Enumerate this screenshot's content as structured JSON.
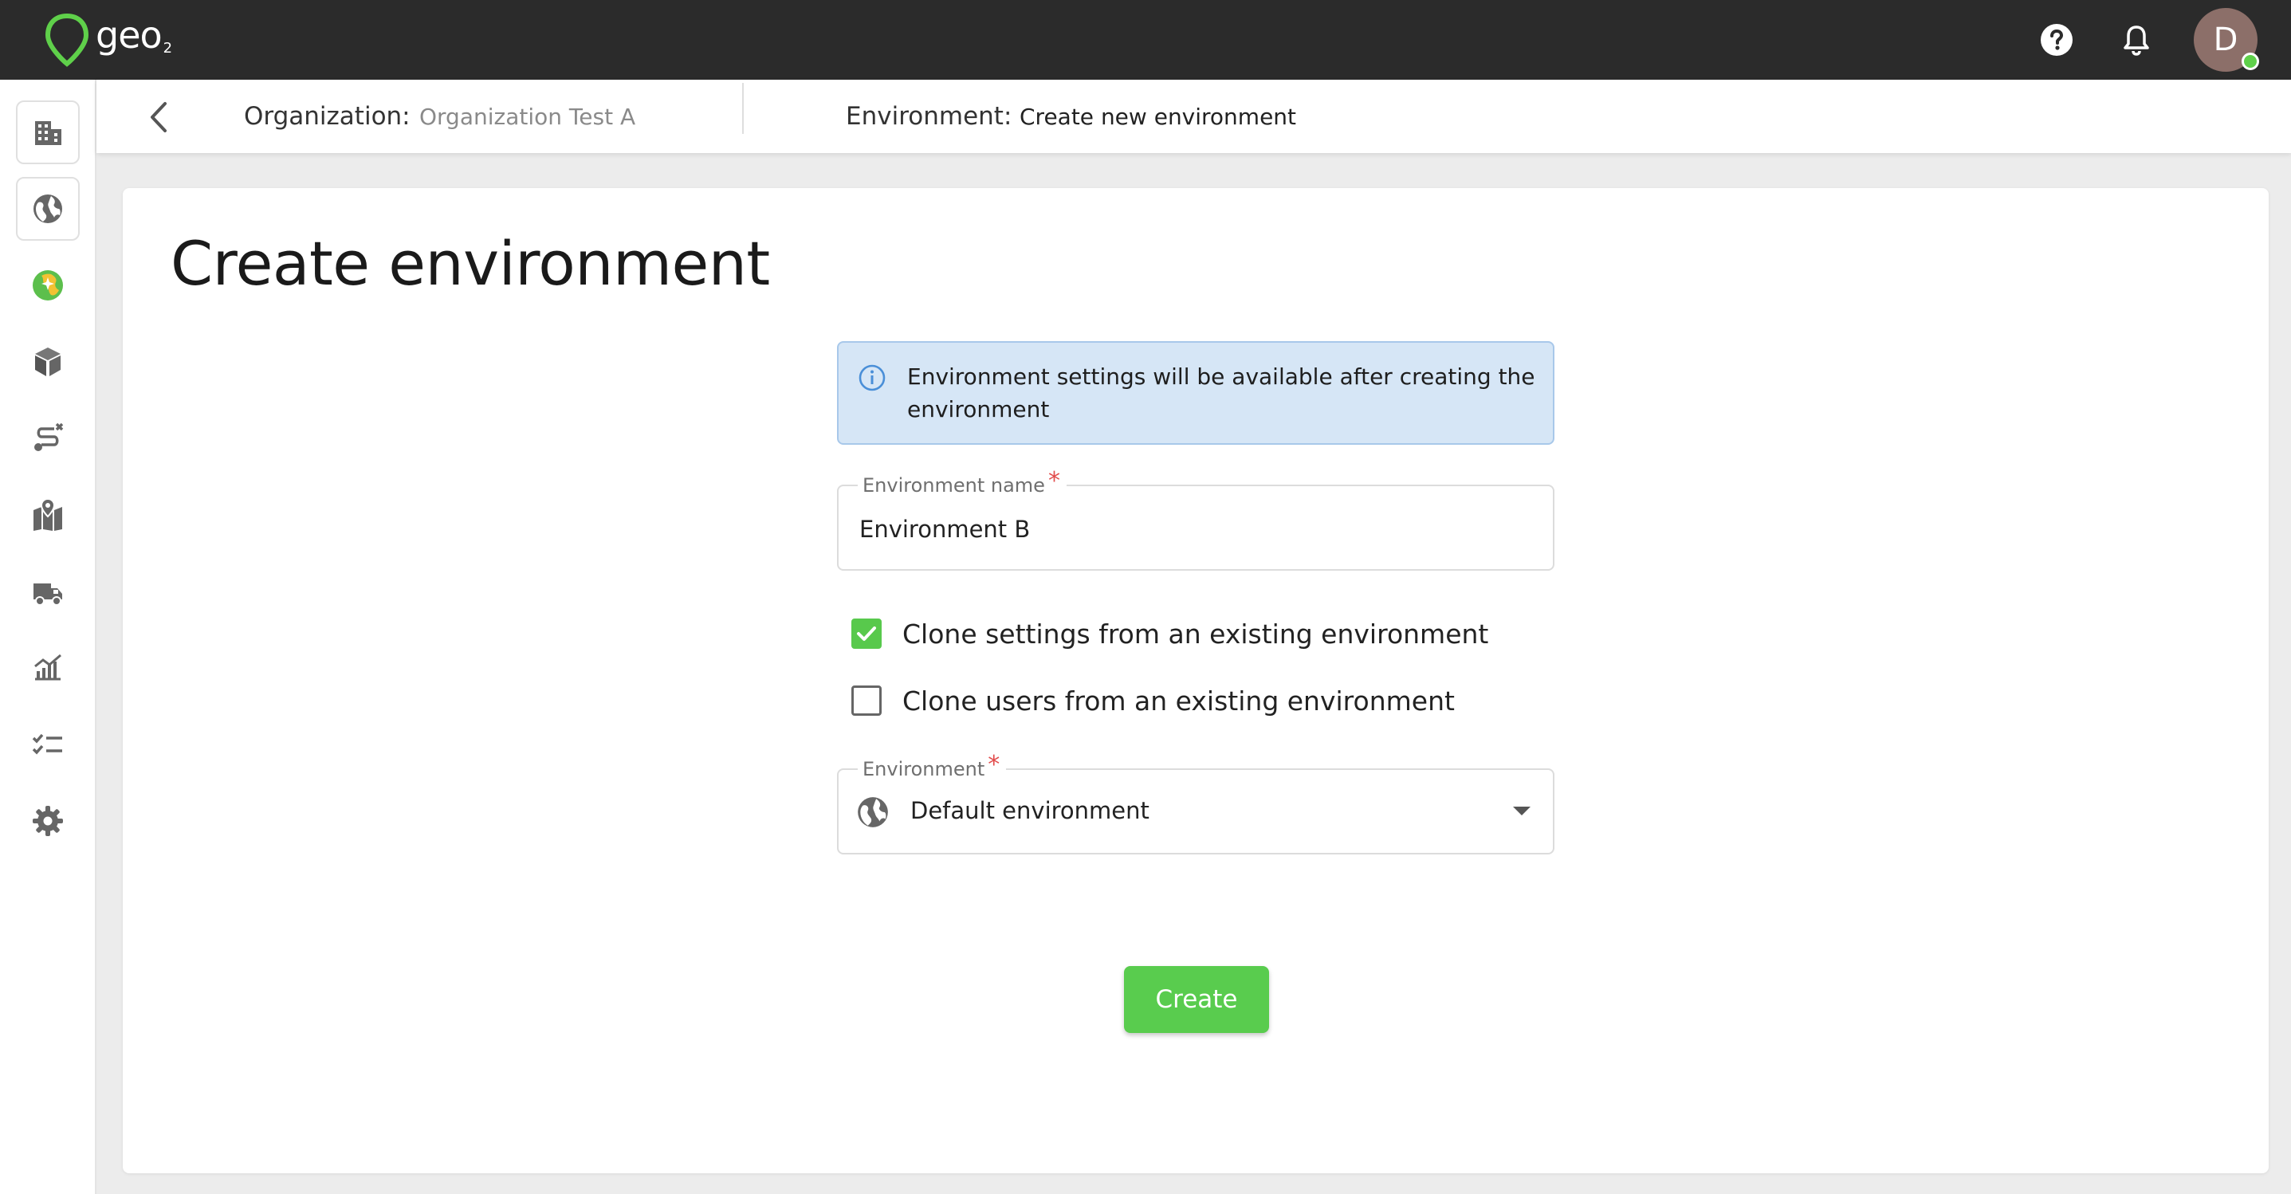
{
  "app": {
    "logo_text": "geo",
    "logo_subscript": "2",
    "avatar_initial": "D"
  },
  "colors": {
    "topbar": "#2b2b2b",
    "accent_green": "#59cc4e",
    "info_bg": "#d6e6f6",
    "required": "#e24c4c"
  },
  "sidebar": {
    "items": [
      {
        "icon": "building-icon"
      },
      {
        "icon": "globe-icon"
      },
      {
        "icon": "colorful-globe-icon"
      },
      {
        "icon": "package-icon"
      },
      {
        "icon": "route-icon"
      },
      {
        "icon": "map-pin-icon"
      },
      {
        "icon": "truck-icon"
      },
      {
        "icon": "chart-icon"
      },
      {
        "icon": "checklist-icon"
      },
      {
        "icon": "gear-icon"
      }
    ]
  },
  "breadcrumb": {
    "org_label": "Organization:",
    "org_value": "Organization Test A",
    "env_label": "Environment:",
    "env_value": "Create new environment"
  },
  "main": {
    "title": "Create environment",
    "info_message": "Environment settings will be available after creating the environment",
    "env_name_field": {
      "label": "Environment name",
      "required_mark": "*",
      "value": "Environment B"
    },
    "clone_settings": {
      "label": "Clone settings from an existing environment",
      "checked": true
    },
    "clone_users": {
      "label": "Clone users from an existing environment",
      "checked": false
    },
    "environment_select": {
      "label": "Environment",
      "required_mark": "*",
      "selected": "Default environment"
    },
    "create_label": "Create"
  }
}
